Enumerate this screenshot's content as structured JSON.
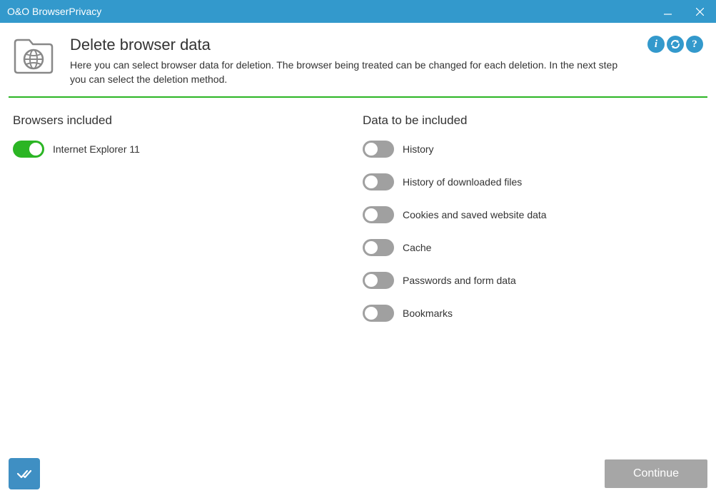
{
  "titlebar": {
    "title": "O&O BrowserPrivacy"
  },
  "header": {
    "title": "Delete browser data",
    "description": "Here you can select browser data for deletion. The browser being treated can be changed for each deletion. In the next step you can select the deletion method."
  },
  "browsers": {
    "section_title": "Browsers included",
    "items": [
      {
        "label": "Internet Explorer 11",
        "enabled": true
      }
    ]
  },
  "data_section": {
    "section_title": "Data to be included",
    "items": [
      {
        "label": "History",
        "enabled": false
      },
      {
        "label": "History of downloaded files",
        "enabled": false
      },
      {
        "label": "Cookies and saved website data",
        "enabled": false
      },
      {
        "label": "Cache",
        "enabled": false
      },
      {
        "label": "Passwords and form data",
        "enabled": false
      },
      {
        "label": "Bookmarks",
        "enabled": false
      }
    ]
  },
  "footer": {
    "continue_label": "Continue"
  }
}
